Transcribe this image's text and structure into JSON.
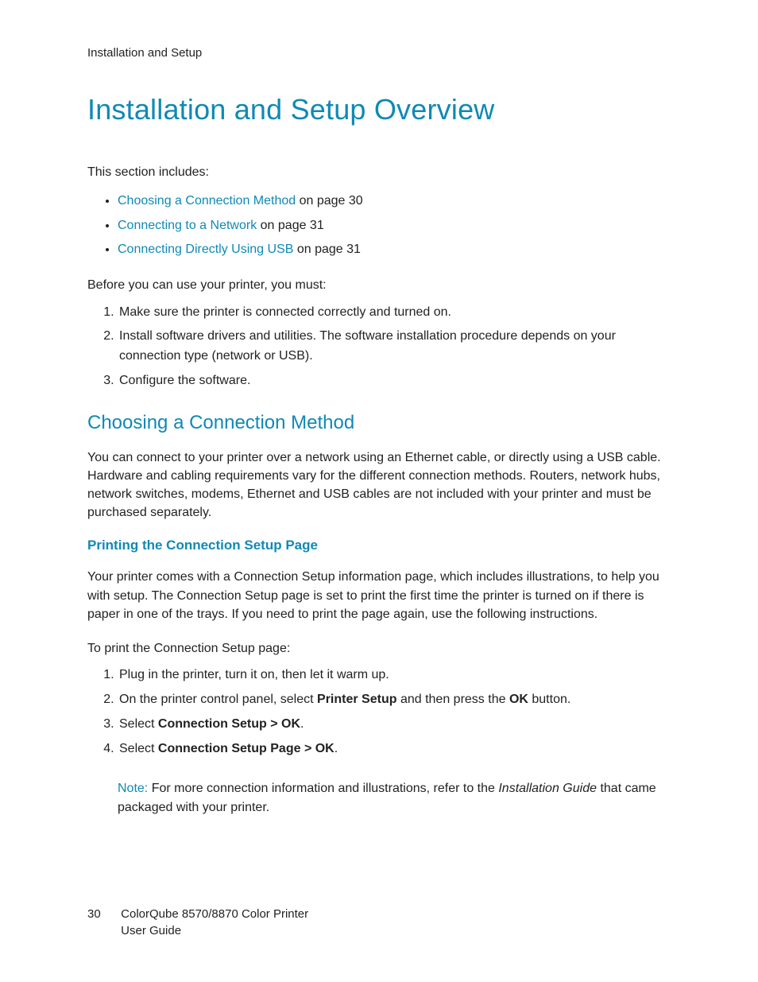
{
  "runningHead": "Installation and Setup",
  "title": "Installation and Setup Overview",
  "intro": "This section includes:",
  "tocBullets": [
    {
      "link": "Choosing a Connection Method",
      "suffix": " on page 30"
    },
    {
      "link": "Connecting to a Network",
      "suffix": " on page 31"
    },
    {
      "link": "Connecting Directly Using USB",
      "suffix": " on page 31"
    }
  ],
  "beforeLead": "Before you can use your printer, you must:",
  "beforeSteps": [
    "Make sure the printer is connected correctly and turned on.",
    "Install software drivers and utilities. The software installation procedure depends on your connection type (network or USB).",
    "Configure the software."
  ],
  "sec1": {
    "heading": "Choosing a Connection Method",
    "para": "You can connect to your printer over a network using an Ethernet cable, or directly using a USB cable. Hardware and cabling requirements vary for the different connection methods. Routers, network hubs, network switches, modems, Ethernet and USB cables are not included with your printer and must be purchased separately."
  },
  "sub1": {
    "heading": "Printing the Connection Setup Page",
    "para1": "Your printer comes with a Connection Setup information page, which includes illustrations, to help you with setup. The Connection Setup page is set to print the first time the printer is turned on if there is paper in one of the trays. If you need to print the page again, use the following instructions.",
    "lead": "To print the Connection Setup page:",
    "steps": {
      "s1": "Plug in the printer, turn it on, then let it warm up.",
      "s2a": "On the printer control panel, select ",
      "s2b1": "Printer Setup",
      "s2c": " and then press the ",
      "s2b2": "OK",
      "s2d": " button.",
      "s3a": "Select ",
      "s3b": "Connection Setup > OK",
      "s3c": ".",
      "s4a": "Select ",
      "s4b": "Connection Setup Page > OK",
      "s4c": "."
    },
    "note": {
      "label": "Note:",
      "t1": " For more connection information and illustrations, refer to the ",
      "doc": "Installation Guide",
      "t2": " that came packaged with your printer."
    }
  },
  "footer": {
    "pageNumber": "30",
    "line1": "ColorQube 8570/8870 Color Printer",
    "line2": "User Guide"
  }
}
